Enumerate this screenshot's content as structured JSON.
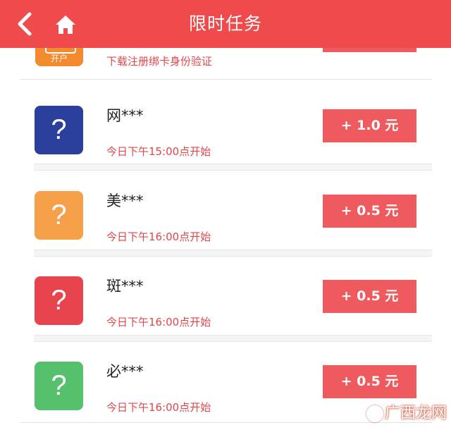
{
  "header": {
    "title": "限时任务",
    "back_icon": "chevron-left-icon",
    "home_icon": "home-icon",
    "background": "#ef4b4c"
  },
  "partial_item": {
    "icon_label": "开户",
    "subtitle": "下载注册绑卡身份验证",
    "icon_color": "#f48a2e"
  },
  "tasks": [
    {
      "name": "网***",
      "time": "今日下午15:00点开始",
      "reward": "+ 1.0 元",
      "icon_color": "#2b3f9c",
      "icon_glyph": "?"
    },
    {
      "name": "美***",
      "time": "今日下午16:00点开始",
      "reward": "+ 0.5 元",
      "icon_color": "#f6a04a",
      "icon_glyph": "?"
    },
    {
      "name": "斑***",
      "time": "今日下午16:00点开始",
      "reward": "+ 0.5 元",
      "icon_color": "#e8444e",
      "icon_glyph": "?"
    },
    {
      "name": "必***",
      "time": "今日下午16:00点开始",
      "reward": "+ 0.5 元",
      "icon_color": "#56c16d",
      "icon_glyph": "?"
    }
  ],
  "watermark": "广西龙网",
  "colors": {
    "accent": "#ee5a5d",
    "time_text": "#e0464a"
  }
}
